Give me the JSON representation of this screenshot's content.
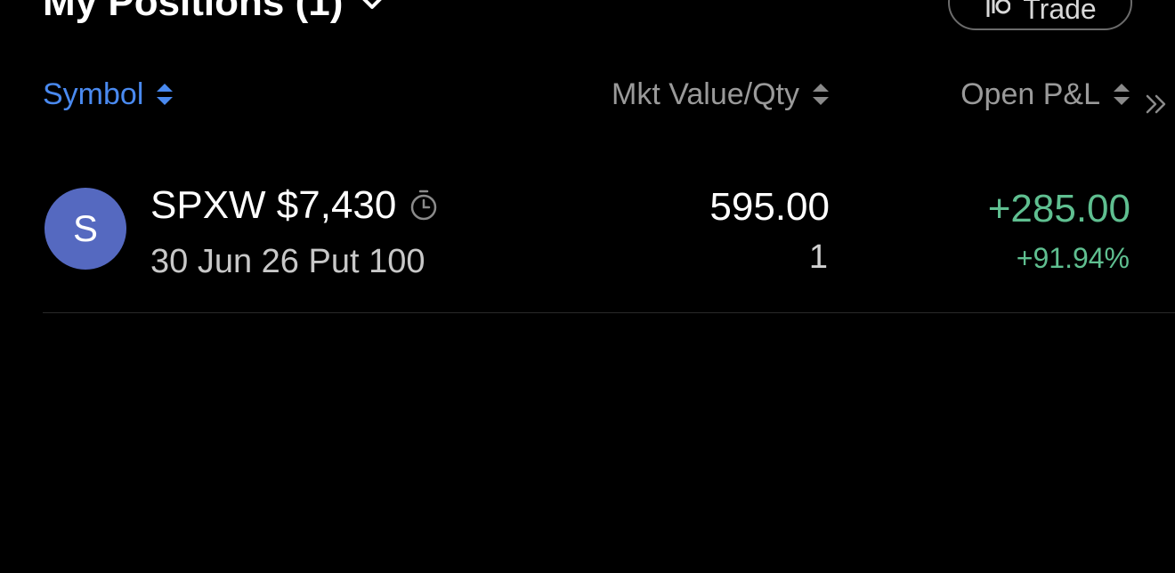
{
  "header": {
    "title": "My Positions (1)",
    "title_icon": "chevron-down-icon",
    "trade_button": {
      "label": "Trade",
      "icon": "trade-icon"
    }
  },
  "columns": {
    "symbol": {
      "label": "Symbol",
      "icon": "sort-icon"
    },
    "mkt_value_qty": {
      "label": "Mkt Value/Qty",
      "icon": "sort-icon"
    },
    "open_pnl": {
      "label": "Open P&L",
      "icon": "sort-icon"
    },
    "expand_icon": "double-chevron-right-icon"
  },
  "positions": [
    {
      "avatar_letter": "S",
      "symbol": "SPXW $7,430",
      "symbol_icon": "timer-icon",
      "details": "30 Jun 26 Put 100",
      "mkt_value": "595.00",
      "qty": "1",
      "open_pnl": "+285.00",
      "open_pnl_pct": "+91.94%"
    }
  ],
  "colors": {
    "background": "#000000",
    "accent": "#4a8af0",
    "positive": "#5fbf90",
    "avatar": "#5569c0",
    "muted": "#9a9a9a"
  }
}
